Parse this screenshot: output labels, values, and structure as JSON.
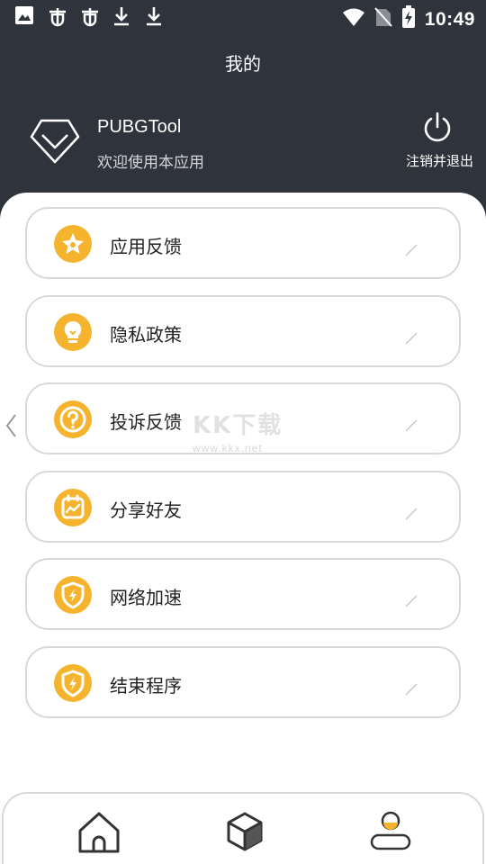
{
  "status_bar": {
    "time": "10:49",
    "left_icons": [
      "image-icon",
      "bug-icon",
      "bug-icon",
      "download-icon",
      "download-icon"
    ],
    "right_icons": [
      "wifi-icon",
      "no-sim-icon",
      "battery-charging-icon"
    ]
  },
  "header": {
    "title": "我的"
  },
  "profile": {
    "app_name": "PUBGTool",
    "welcome": "欢迎使用本应用",
    "logout_label": "注销并退出"
  },
  "menu": {
    "items": [
      {
        "label": "应用反馈",
        "icon": "star-badge-icon"
      },
      {
        "label": "隐私政策",
        "icon": "lightbulb-icon"
      },
      {
        "label": "投诉反馈",
        "icon": "question-icon"
      },
      {
        "label": "分享好友",
        "icon": "calendar-chart-icon"
      },
      {
        "label": "网络加速",
        "icon": "shield-bolt-icon"
      },
      {
        "label": "结束程序",
        "icon": "shield-bolt-icon"
      }
    ]
  },
  "watermark": {
    "brand": "KK下载",
    "url": "www.kkx.net"
  },
  "bottom_nav": {
    "items": [
      "home-icon",
      "cube-icon",
      "user-icon"
    ],
    "active": "user-icon"
  },
  "colors": {
    "header_bg": "#2f333b",
    "accent": "#f5b32e",
    "card_border": "#d9d9d9"
  }
}
